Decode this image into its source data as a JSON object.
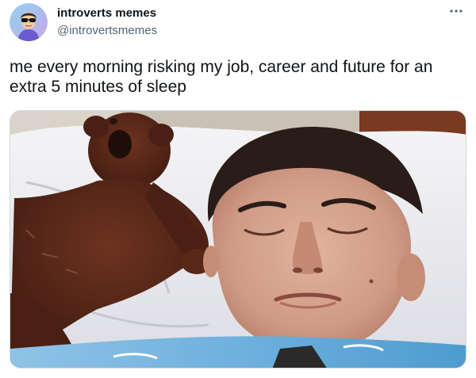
{
  "tweet": {
    "display_name": "introverts memes",
    "handle": "@introvertsmemes",
    "text": "me every morning risking my job, career and future for an extra 5 minutes of sleep"
  },
  "icons": {
    "more": "more-horizontal-icon",
    "avatar": "sunglasses-avatar"
  },
  "colors": {
    "name": "#0f1419",
    "secondary": "#536471",
    "border": "#cfd9de"
  }
}
